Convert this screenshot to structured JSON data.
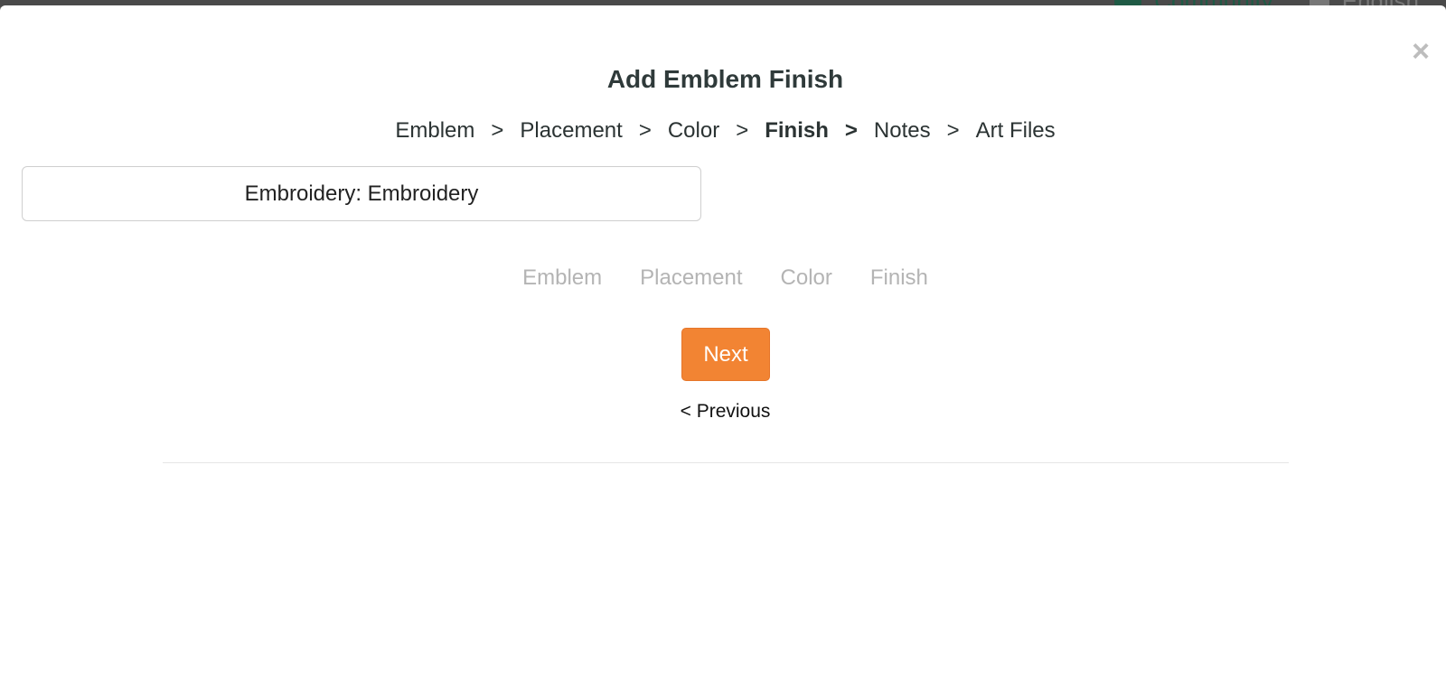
{
  "background_nav": {
    "community_label": "Community",
    "language_label": "English"
  },
  "modal": {
    "title": "Add Emblem Finish",
    "close_glyph": "×",
    "breadcrumb": [
      {
        "label": "Emblem",
        "active": false
      },
      {
        "label": "Placement",
        "active": false
      },
      {
        "label": "Color",
        "active": false
      },
      {
        "label": "Finish",
        "active": true
      },
      {
        "label": "Notes",
        "active": false
      },
      {
        "label": "Art Files",
        "active": false
      }
    ],
    "breadcrumb_separator": ">",
    "finish_option": "Embroidery: Embroidery",
    "summary_steps": [
      "Emblem",
      "Placement",
      "Color",
      "Finish"
    ],
    "next_label": "Next",
    "previous_label": "< Previous"
  },
  "colors": {
    "accent": "#f28433",
    "community_green": "#1f5a45",
    "muted_text": "#b4b4b4"
  },
  "icons": {
    "close": "close-icon",
    "community": "community-icon",
    "language": "language-icon"
  }
}
